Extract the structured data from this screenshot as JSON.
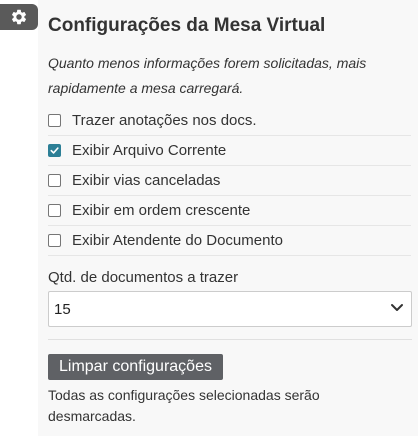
{
  "header": {
    "gear_icon": "gear-icon",
    "title": "Configurações da Mesa Virtual"
  },
  "hint": "Quanto menos informações forem solicitadas, mais rapidamente a mesa carregará.",
  "options": [
    {
      "label": "Trazer anotações nos docs.",
      "checked": false
    },
    {
      "label": "Exibir Arquivo Corrente",
      "checked": true
    },
    {
      "label": "Exibir vias canceladas",
      "checked": false
    },
    {
      "label": "Exibir em ordem crescente",
      "checked": false
    },
    {
      "label": "Exibir Atendente do Documento",
      "checked": false
    }
  ],
  "quantity": {
    "label": "Qtd. de documentos a trazer",
    "selected": "15"
  },
  "clear": {
    "button_label": "Limpar configurações",
    "note": "Todas as configurações selecionadas serão desmarcadas."
  },
  "colors": {
    "accent": "#2c7f96",
    "panel_background": "#f8f8f8",
    "button_background": "#5f6165"
  }
}
